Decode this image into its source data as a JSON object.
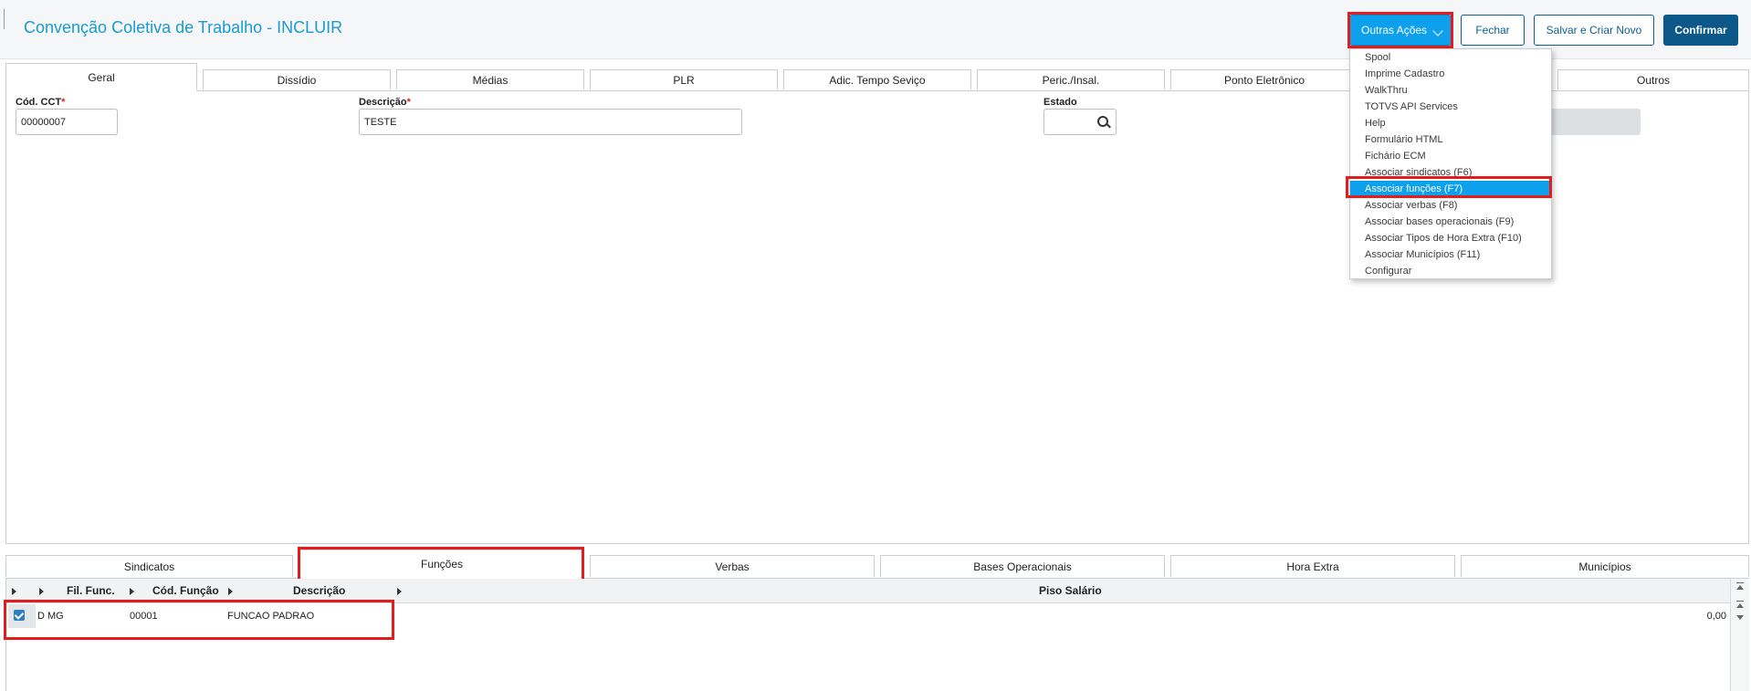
{
  "header": {
    "title": "Convenção Coletiva de Trabalho - INCLUIR",
    "outras_acoes": "Outras Ações",
    "fechar": "Fechar",
    "salvar_criar": "Salvar e Criar Novo",
    "confirmar": "Confirmar"
  },
  "tabs": [
    {
      "label": "Geral"
    },
    {
      "label": "Dissídio"
    },
    {
      "label": "Médias"
    },
    {
      "label": "PLR"
    },
    {
      "label": "Adic. Tempo Seviço"
    },
    {
      "label": "Peric./Insal."
    },
    {
      "label": "Ponto Eletrônico"
    },
    {
      "label": "Outros"
    }
  ],
  "form": {
    "cod_label": "Cód. CCT",
    "cod_value": "00000007",
    "desc_label": "Descrição",
    "desc_value": "TESTE",
    "estado_label": "Estado",
    "required_mark": "*"
  },
  "menu": {
    "items": [
      {
        "label": "Spool"
      },
      {
        "label": "Imprime Cadastro"
      },
      {
        "label": "WalkThru"
      },
      {
        "label": "TOTVS API Services"
      },
      {
        "label": "Help"
      },
      {
        "label": "Formulário HTML"
      },
      {
        "label": "Fichário ECM"
      },
      {
        "label": "Associar sindicatos (F6)"
      },
      {
        "label": "Associar funções (F7)"
      },
      {
        "label": "Associar verbas (F8)"
      },
      {
        "label": "Associar bases operacionais (F9)"
      },
      {
        "label": "Associar Tipos de Hora Extra (F10)"
      },
      {
        "label": "Associar Municípios (F11)"
      },
      {
        "label": "Configurar"
      }
    ]
  },
  "bottom_tabs": [
    {
      "label": "Sindicatos"
    },
    {
      "label": "Funções"
    },
    {
      "label": "Verbas"
    },
    {
      "label": "Bases Operacionais"
    },
    {
      "label": "Hora Extra"
    },
    {
      "label": "Municípios"
    }
  ],
  "grid": {
    "columns": [
      "Fil. Func.",
      "Cód. Função",
      "Descrição",
      "Piso Salário"
    ],
    "rows": [
      {
        "fil": "D MG",
        "cod": "00001",
        "desc": "FUNCAO PADRAO",
        "piso": "0,00"
      }
    ]
  },
  "colors": {
    "accent": "#0da0ec",
    "primary": "#0b5889",
    "highlight": "#e31d1d"
  }
}
